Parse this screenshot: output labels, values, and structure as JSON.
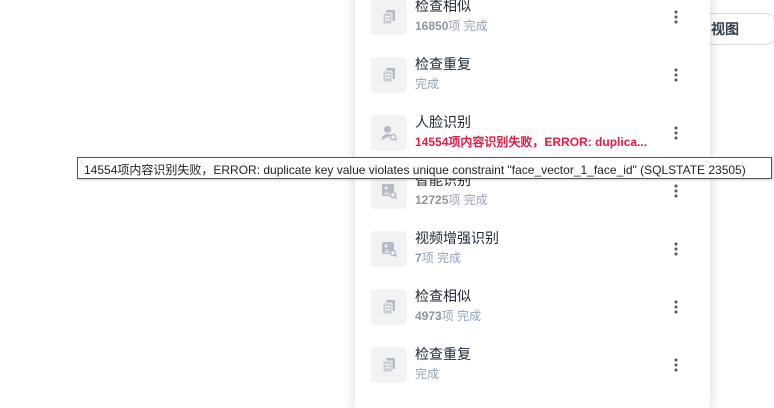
{
  "background": {
    "view_button_label": "视图"
  },
  "tasks": [
    {
      "title": "检查相似",
      "count": "16850",
      "status": "项 完成",
      "icon": "copy-icon",
      "error": false
    },
    {
      "title": "检查重复",
      "count": "",
      "status": "完成",
      "icon": "copy-icon",
      "error": false
    },
    {
      "title": "人脸识别",
      "count": "",
      "status": "14554项内容识别失败，ERROR: duplica...",
      "icon": "face-person-icon",
      "error": true
    },
    {
      "title": "智能识别",
      "count": "12725",
      "status": "项 完成",
      "icon": "image-scan-icon",
      "error": false
    },
    {
      "title": "视频增强识别",
      "count": "7",
      "status": "项 完成",
      "icon": "image-scan-icon",
      "error": false
    },
    {
      "title": "检查相似",
      "count": "4973",
      "status": "项 完成",
      "icon": "copy-icon",
      "error": false
    },
    {
      "title": "检查重复",
      "count": "",
      "status": "完成",
      "icon": "copy-icon",
      "error": false
    }
  ],
  "tooltip": {
    "text": "14554项内容识别失败，ERROR: duplicate key value violates unique constraint \"face_vector_1_face_id\" (SQLSTATE 23505)"
  },
  "colors": {
    "error": "#e11d48",
    "muted": "#94a3b8",
    "icon_bg": "#f1f2f4",
    "icon": "#b5bac4"
  }
}
